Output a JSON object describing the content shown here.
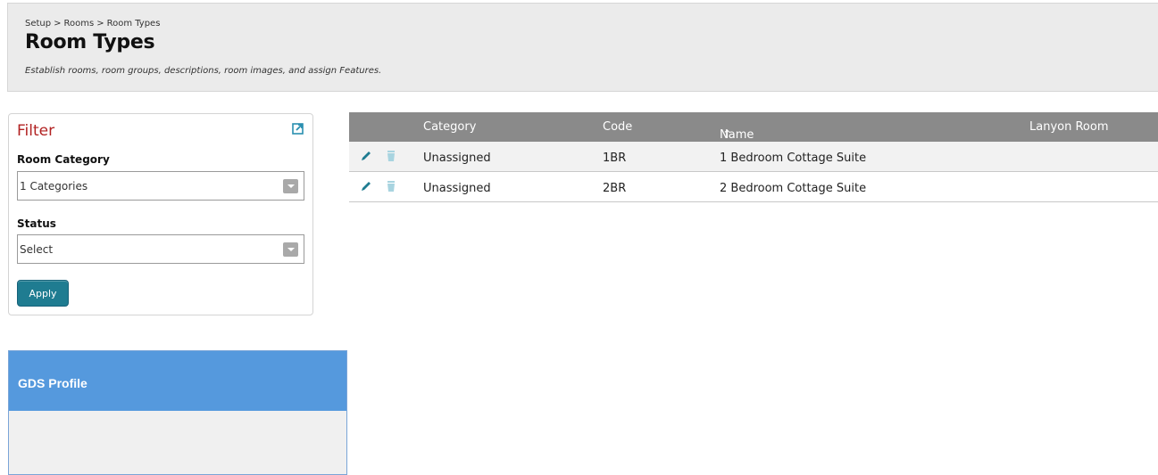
{
  "header": {
    "breadcrumb": [
      "Setup",
      "Rooms",
      "Room Types"
    ],
    "breadcrumb_separator": ">",
    "title": "Room Types",
    "subtitle": "Establish rooms, room groups, descriptions, room images, and assign Features."
  },
  "filter": {
    "title": "Filter",
    "room_category_label": "Room Category",
    "room_category_value": "1 Categories",
    "status_label": "Status",
    "status_value": "Select",
    "apply_label": "Apply"
  },
  "gds": {
    "title": "GDS Profile"
  },
  "table": {
    "columns": [
      "Category",
      "Code",
      "Name",
      "Lanyon Room"
    ],
    "sort_indicator": "↑",
    "rows": [
      {
        "category": "Unassigned",
        "code": "1BR",
        "name": "1 Bedroom Cottage Suite"
      },
      {
        "category": "Unassigned",
        "code": "2BR",
        "name": "2 Bedroom Cottage Suite"
      }
    ]
  },
  "colors": {
    "accent": "#1f7c91",
    "filter_title": "#b22222",
    "gds_header": "#5599dd",
    "table_header": "#8a8a8a"
  }
}
